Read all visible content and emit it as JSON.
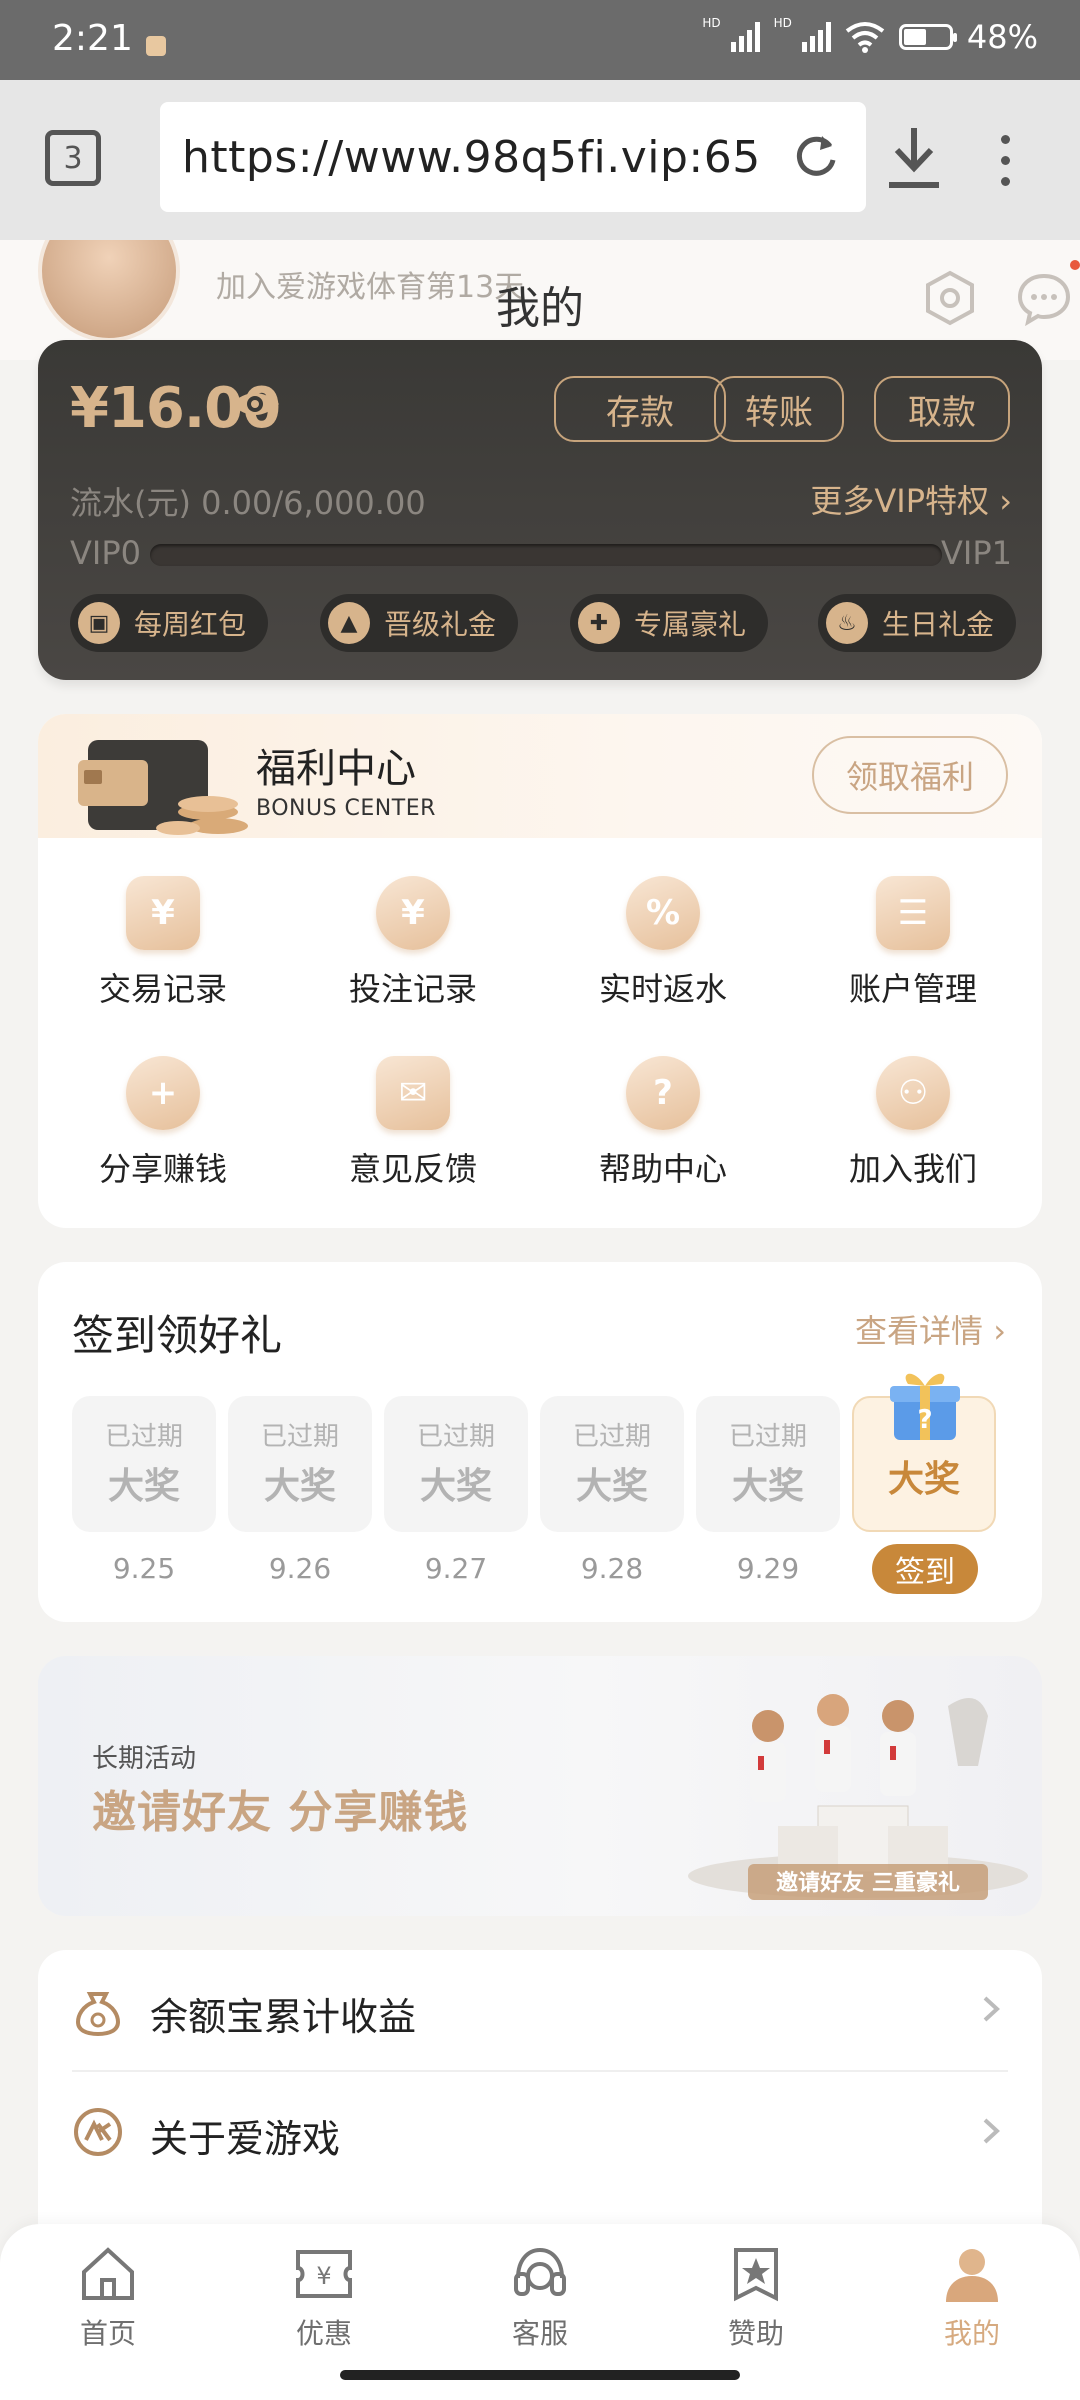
{
  "status_bar": {
    "time": "2:21",
    "battery": "48%",
    "hd1": "HD",
    "hd2": "HD"
  },
  "browser": {
    "tab_count": "3",
    "url": "https://www.98q5fi.vip:65"
  },
  "header": {
    "title": "我的",
    "joined_text": "加入爱游戏体育第13天"
  },
  "wallet": {
    "balance": "¥16.00",
    "buttons": [
      "存款",
      "转账",
      "取款"
    ],
    "flow_text": "流水(元) 0.00/6,000.00",
    "more_vip": "更多VIP特权",
    "vip_current": "VIP0",
    "vip_next": "VIP1",
    "vip_progress": 0,
    "perks": [
      "每周红包",
      "晋级礼金",
      "专属豪礼",
      "生日礼金"
    ]
  },
  "bonus": {
    "title": "福利中心",
    "subtitle": "BONUS CENTER",
    "claim_button": "领取福利",
    "items": [
      "交易记录",
      "投注记录",
      "实时返水",
      "账户管理",
      "分享赚钱",
      "意见反馈",
      "帮助中心",
      "加入我们"
    ]
  },
  "checkin": {
    "title": "签到领好礼",
    "detail_link": "查看详情",
    "days": [
      {
        "status": "已过期",
        "prize": "大奖",
        "date": "9.25"
      },
      {
        "status": "已过期",
        "prize": "大奖",
        "date": "9.26"
      },
      {
        "status": "已过期",
        "prize": "大奖",
        "date": "9.27"
      },
      {
        "status": "已过期",
        "prize": "大奖",
        "date": "9.28"
      },
      {
        "status": "已过期",
        "prize": "大奖",
        "date": "9.29"
      },
      {
        "status": "",
        "prize": "大奖",
        "date": ""
      }
    ],
    "sign_button": "签到"
  },
  "invite": {
    "tag": "长期活动",
    "headline": "邀请好友 分享赚钱",
    "art_text": "邀请好友 三重豪礼"
  },
  "list": {
    "items": [
      "余额宝累计收益",
      "关于爱游戏"
    ]
  },
  "tabbar": {
    "tabs": [
      "首页",
      "优惠",
      "客服",
      "赞助",
      "我的"
    ]
  },
  "colors": {
    "accent": "#c9a583",
    "gold": "#d7b48c",
    "wallet_bg": "#3a3936",
    "signin": "#c8883a"
  }
}
